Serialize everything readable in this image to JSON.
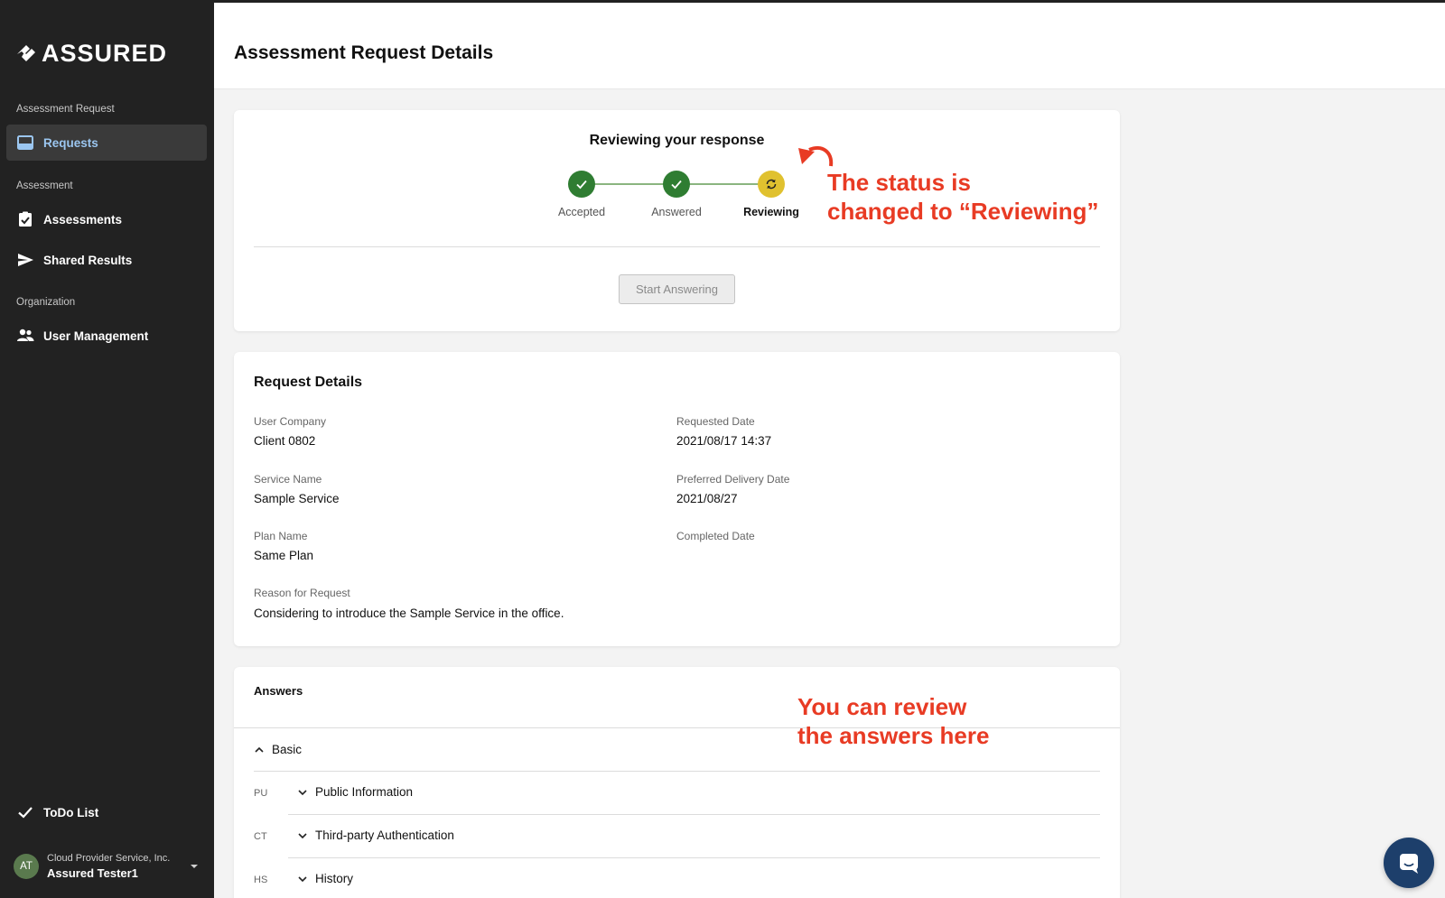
{
  "brand": {
    "name": "ASSURED"
  },
  "sidebar": {
    "sections": [
      {
        "label": "Assessment Request"
      },
      {
        "label": "Assessment"
      },
      {
        "label": "Organization"
      }
    ],
    "items": [
      {
        "label": "Requests",
        "icon": "inbox-icon",
        "active": true
      },
      {
        "label": "Assessments",
        "icon": "clipboard-check-icon"
      },
      {
        "label": "Shared Results",
        "icon": "send-icon"
      },
      {
        "label": "User Management",
        "icon": "users-icon"
      },
      {
        "label": "ToDo List",
        "icon": "check-icon"
      }
    ],
    "user": {
      "initials": "AT",
      "company": "Cloud Provider Service, Inc.",
      "name": "Assured Tester1"
    }
  },
  "header": {
    "title": "Assessment Request Details"
  },
  "status": {
    "title": "Reviewing your response",
    "steps": [
      {
        "label": "Accepted",
        "state": "done"
      },
      {
        "label": "Answered",
        "state": "done"
      },
      {
        "label": "Reviewing",
        "state": "current"
      }
    ],
    "start_button": "Start Answering"
  },
  "details": {
    "title": "Request Details",
    "fields": [
      {
        "label": "User Company",
        "value": "Client 0802"
      },
      {
        "label": "Requested Date",
        "value": "2021/08/17 14:37"
      },
      {
        "label": "Service Name",
        "value": "Sample Service"
      },
      {
        "label": "Preferred Delivery Date",
        "value": "2021/08/27"
      },
      {
        "label": "Plan Name",
        "value": "Same Plan"
      },
      {
        "label": "Completed Date",
        "value": ""
      },
      {
        "label": "Reason for Request",
        "value": "Considering to introduce the Sample Service in the office."
      }
    ]
  },
  "answers": {
    "title": "Answers",
    "group": "Basic",
    "items": [
      {
        "code": "PU",
        "label": "Public Information"
      },
      {
        "code": "CT",
        "label": "Third-party Authentication"
      },
      {
        "code": "HS",
        "label": "History"
      }
    ]
  },
  "annotations": {
    "status_line1": "The status is",
    "status_line2": "changed to “Reviewing”",
    "review_line1": "You can review",
    "review_line2": "the answers here"
  },
  "colors": {
    "sidebar_bg": "#222222",
    "active_text": "#9bc6f0",
    "step_done": "#2f7d32",
    "step_current": "#e0c12f",
    "annotation": "#e83b24"
  }
}
